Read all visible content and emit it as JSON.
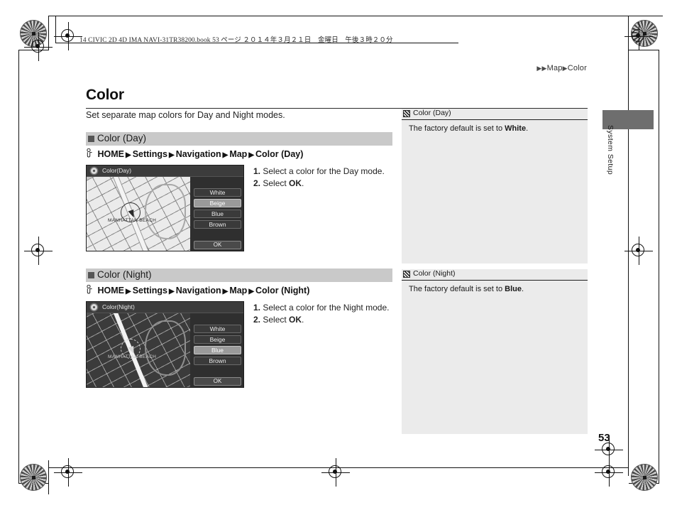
{
  "printer_header": {
    "text": "14 CIVIC 2D 4D IMA NAVI-31TR38200.book   53 ページ   ２０１４年３月２１日　金曜日　午後３時２０分"
  },
  "breadcrumb": {
    "arrow1": "▶▶",
    "item1": "Map",
    "arrow2": "▶",
    "item2": "Color"
  },
  "page": {
    "title": "Color",
    "intro": "Set separate map colors for Day and Night modes.",
    "number": "53",
    "side_tab_label": "System Setup"
  },
  "sections": [
    {
      "band_label": "Color (Day)",
      "path": {
        "hand_icon": "hand-pointer-icon",
        "items": [
          "HOME",
          "Settings",
          "Navigation",
          "Map",
          "Color (Day)"
        ],
        "separator": "▶"
      },
      "screenshot": {
        "gear_icon": "gear-icon",
        "title": "Color(Day)",
        "map_label": "MANHATTAN BEACH",
        "mode": "day",
        "options": [
          "White",
          "Beige",
          "Blue",
          "Brown"
        ],
        "selected": "Beige",
        "ok_label": "OK"
      },
      "steps": [
        {
          "num": "1.",
          "text": "Select a color for the Day mode."
        },
        {
          "num": "2.",
          "text_pre": "Select ",
          "text_bold": "OK",
          "text_post": "."
        }
      ]
    },
    {
      "band_label": "Color (Night)",
      "path": {
        "hand_icon": "hand-pointer-icon",
        "items": [
          "HOME",
          "Settings",
          "Navigation",
          "Map",
          "Color (Night)"
        ],
        "separator": "▶"
      },
      "screenshot": {
        "gear_icon": "gear-icon",
        "title": "Color(Night)",
        "map_label": "MANHATTAN BEACH",
        "mode": "night",
        "options": [
          "White",
          "Beige",
          "Blue",
          "Brown"
        ],
        "selected": "Blue",
        "ok_label": "OK"
      },
      "steps": [
        {
          "num": "1.",
          "text": "Select a color for the Night mode."
        },
        {
          "num": "2.",
          "text_pre": "Select ",
          "text_bold": "OK",
          "text_post": "."
        }
      ]
    }
  ],
  "notes": [
    {
      "icon": "hatched-square-icon",
      "title": "Color (Day)",
      "body_pre": "The factory default is set to ",
      "body_bold": "White",
      "body_post": "."
    },
    {
      "icon": "hatched-square-icon",
      "title": "Color (Night)",
      "body_pre": "The factory default is set to ",
      "body_bold": "Blue",
      "body_post": "."
    }
  ],
  "colors": {
    "band": "#c9c9c9",
    "note_bg": "#ebebeb",
    "tab": "#6e6e6e",
    "device_bg": "#2b2b2b"
  }
}
